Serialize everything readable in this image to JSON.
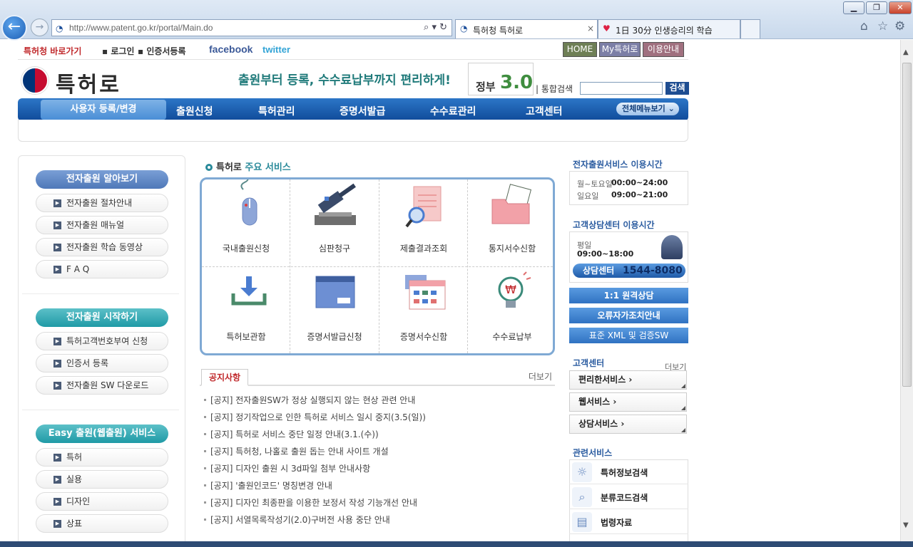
{
  "browser": {
    "url": "http://www.patent.go.kr/portal/Main.do",
    "tabs": [
      {
        "title": "특허청 특허로",
        "close": "×"
      },
      {
        "title": "1日 30分 인생승리의 학습"
      }
    ]
  },
  "topbar": {
    "quick_link": "특허청 바로가기",
    "login": "로그인",
    "cert_register": "인증서등록",
    "facebook": "facebook",
    "twitter": "twitter",
    "buttons": [
      "HOME",
      "My특허로",
      "이용안내"
    ]
  },
  "header": {
    "logo_text": "특허로",
    "slogan": "출원부터 등록, 수수료납부까지 편리하게!",
    "gov_badge_text": "정부",
    "gov_badge_num": "3.0",
    "search_label": "| 통합검색",
    "search_button": "검색"
  },
  "gnb": {
    "active": "사용자 등록/변경",
    "items": [
      "출원신청",
      "특허관리",
      "증명서발급",
      "수수료관리",
      "고객센터"
    ],
    "all_menu": "전체메뉴보기"
  },
  "left": {
    "sections": [
      {
        "title": "전자출원 알아보기",
        "color": "#4f78b8",
        "items": [
          "전자출원 절차안내",
          "전자출원 매뉴얼",
          "전자출원 학습 동영상",
          "F A Q"
        ]
      },
      {
        "title": "전자출원 시작하기",
        "color": "#1f9aa6",
        "items": [
          "특허고객번호부여 신청",
          "인증서 등록",
          "전자출원 SW 다운로드"
        ]
      },
      {
        "title": "Easy 출원(웹출원) 서비스",
        "color": "#1f9aa6",
        "items": [
          "특허",
          "실용",
          "디자인",
          "상표"
        ]
      }
    ]
  },
  "services": {
    "title_prefix": "특허로",
    "title_highlight": "주요 서비스",
    "items": [
      {
        "label": "국내출원신청",
        "icon": "mouse-icon"
      },
      {
        "label": "심판청구",
        "icon": "gavel-icon"
      },
      {
        "label": "제출결과조회",
        "icon": "document-search-icon"
      },
      {
        "label": "통지서수신함",
        "icon": "folder-icon"
      },
      {
        "label": "특허보관함",
        "icon": "download-tray-icon"
      },
      {
        "label": "증명서발급신청",
        "icon": "calendar-card-icon"
      },
      {
        "label": "증명서수신함",
        "icon": "calendar-window-icon"
      },
      {
        "label": "수수료납부",
        "icon": "lightbulb-won-icon"
      }
    ]
  },
  "notices": {
    "tab": "공지사항",
    "more": "더보기",
    "items": [
      "[공지] 전자출원SW가 정상 실행되지 않는 현상 관련 안내",
      "[공지] 정기작업으로 인한 특허로 서비스 일시 중지(3.5(일))",
      "[공지] 특허로 서비스 중단 일정 안내(3.1.(수))",
      "[공지] 특허청, 나홀로 출원 돕는 안내 사이트 개설",
      "[공지] 디자인 출원 시 3d파일 첨부 안내사항",
      "[공지] '출원인코드' 명칭변경 안내",
      "[공지] 디자인 최종판을 이용한 보정서 작성 기능개선 안내",
      "[공지] 서열목록작성기(2.0)구버전 사용 중단 안내"
    ]
  },
  "right": {
    "hours_title": "전자출원서비스 이용시간",
    "hours": [
      {
        "day": "월~토요일",
        "time": "00:00~24:00"
      },
      {
        "day": "일요일",
        "time": "09:00~21:00"
      }
    ],
    "cs_title": "고객상담센터 이용시간",
    "cs_day": "평일",
    "cs_time": "09:00~18:00",
    "cs_center_label": "상담센터",
    "cs_phone": "1544-8080",
    "buttons": [
      "1:1 원격상담",
      "오류자가조치안내",
      "표준 XML 및 검증SW"
    ],
    "center_title": "고객센터",
    "center_more": "더보기",
    "center_items": [
      "편리한서비스",
      "웹서비스",
      "상담서비스"
    ],
    "related_title": "관련서비스",
    "related_items": [
      "특허정보검색",
      "분류코드검색",
      "법령자료"
    ]
  },
  "colors": {
    "accent": "#1e4d91",
    "teal": "#1f9aa6",
    "red": "#c0282b"
  }
}
